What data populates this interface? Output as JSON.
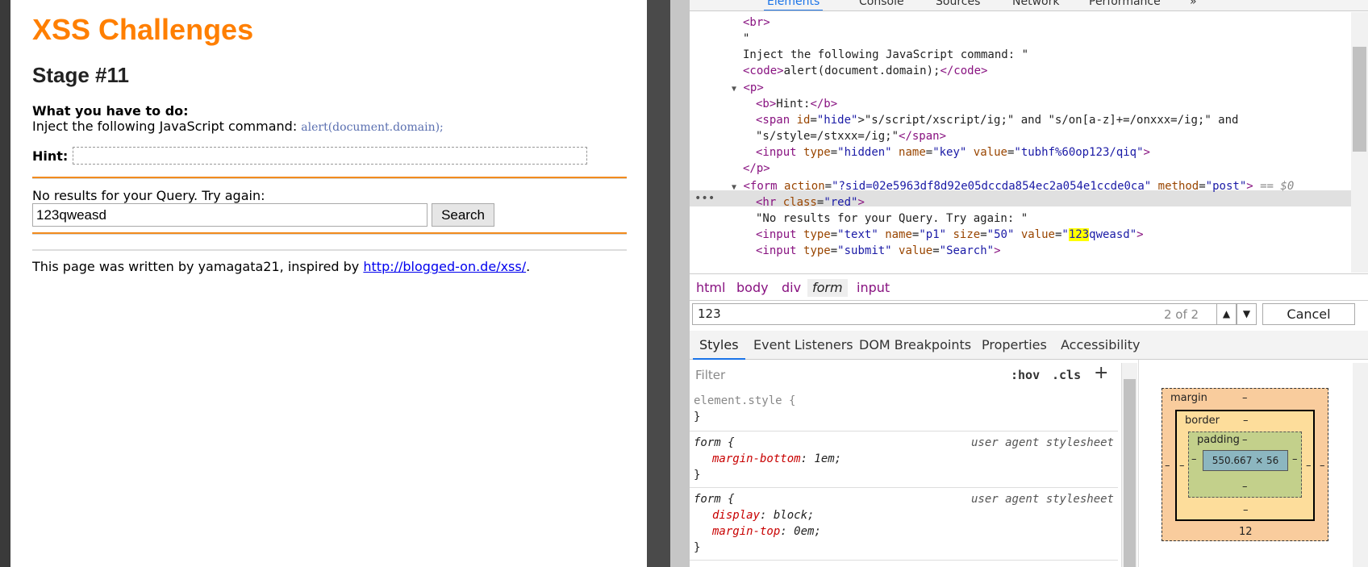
{
  "page": {
    "title": "XSS Challenges",
    "stage": "Stage #11",
    "todo_label": "What you have to do:",
    "inject_text": "Inject the following JavaScript command:",
    "inject_code": "alert(document.domain);",
    "hint_label": "Hint:",
    "no_results": "No results for your Query. Try again:",
    "query_value": "123qweasd",
    "search_button": "Search",
    "footer_text": "This page was written by yamagata21, inspired by",
    "footer_link": "http://blogged-on.de/xss/",
    "footer_end": ".",
    "accent": "#ff7f00"
  },
  "devtools": {
    "tabs": [
      "Elements",
      "Console",
      "Sources",
      "Network",
      "Performance",
      "»"
    ],
    "active_tab": "Elements",
    "dom_lines": {
      "l1": "<br>",
      "l2": "\"",
      "l3": "Inject the following JavaScript command: \"",
      "l4_open": "<code>",
      "l4_text": "alert(document.domain);",
      "l4_close": "</code>",
      "l5": "<p>",
      "l6_open": "<b>",
      "l6_text": "Hint:",
      "l6_close": "</b>",
      "l7_a": "<span ",
      "l7_attr": "id",
      "l7_val": "\"hide\"",
      "l7_text": ">\"s/script/xscript/ig;\" and \"s/on[a-z]+=/onxxx=/ig;\" and",
      "l8_text": "\"s/style=/stxxx=/ig;\"",
      "l8_close": "</span>",
      "l9_tag": "<input ",
      "l9_a1": "type",
      "l9_v1": "\"hidden\"",
      "l9_a2": "name",
      "l9_v2": "\"key\"",
      "l9_a3": "value",
      "l9_v3": "\"tubhf%60op123/qiq\"",
      "l9_end": ">",
      "l10": "</p>",
      "l11_tag": "<form ",
      "l11_a1": "action",
      "l11_v1": "\"?sid=02e5963df8d92e05dccda854ec2a054e1ccde0ca\"",
      "l11_a2": "method",
      "l11_v2": "\"post\"",
      "l11_end": ">",
      "l11_eq": "== $0",
      "l12_tag": "<hr ",
      "l12_a": "class",
      "l12_v": "\"red\"",
      "l12_end": ">",
      "l13": "\"No results for your Query. Try again: \"",
      "l14_tag": "<input ",
      "l14_a1": "type",
      "l14_v1": "\"text\"",
      "l14_a2": "name",
      "l14_v2": "\"p1\"",
      "l14_a3": "size",
      "l14_v3": "\"50\"",
      "l14_a4": "value",
      "l14_v4a": "\"",
      "l14_hl": "123",
      "l14_v4b": "qweasd\"",
      "l14_end": ">",
      "l15_tag": "<input ",
      "l15_a1": "type",
      "l15_v1": "\"submit\"",
      "l15_a2": "value",
      "l15_v2": "\"Search\"",
      "l15_end": ">"
    },
    "breadcrumbs": [
      "html",
      "body",
      "div",
      "form",
      "input"
    ],
    "search_value": "123",
    "search_count": "2 of 2",
    "cancel": "Cancel",
    "styles_tabs": [
      "Styles",
      "Event Listeners",
      "DOM Breakpoints",
      "Properties",
      "Accessibility"
    ],
    "filter_placeholder": "Filter",
    "hov": ":hov",
    "cls": ".cls",
    "rules": {
      "r1_sel": "element.style {",
      "r1_close": "}",
      "r2_sel": "form {",
      "r2_src": "user agent stylesheet",
      "r2_p1": "margin-bottom",
      "r2_v1": ": 1em;",
      "r2_close": "}",
      "r3_sel": "form {",
      "r3_src": "user agent stylesheet",
      "r3_p1": "display",
      "r3_v1": ": block;",
      "r3_p2": "margin-top",
      "r3_v2": ": 0em;",
      "r3_close": "}"
    },
    "boxmodel": {
      "margin": "margin",
      "border": "border",
      "padding": "padding",
      "dash": "–",
      "content": "550.667 × 56",
      "margin_bottom": "12"
    }
  }
}
